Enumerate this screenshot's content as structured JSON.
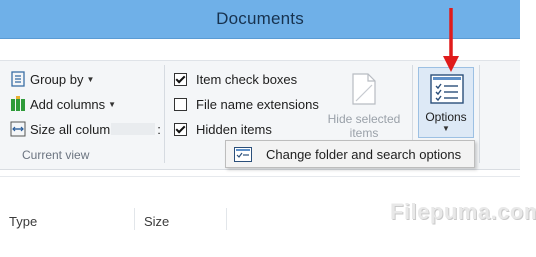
{
  "window": {
    "title": "Documents"
  },
  "ribbon": {
    "layout_group": {
      "group_by": "Group by",
      "add_columns": "Add columns",
      "size_all_columns": "Size all colum",
      "size_all_columns_suffix": ":",
      "caption": "Current view"
    },
    "show_hide_group": {
      "item_check_boxes": {
        "label": "Item check boxes",
        "checked": true
      },
      "file_name_extensions": {
        "label": "File name extensions",
        "checked": false
      },
      "hidden_items": {
        "label": "Hidden items",
        "checked": true
      },
      "hide_selected_line1": "Hide selected",
      "hide_selected_line2": "items"
    },
    "options_button": {
      "label": "Options"
    }
  },
  "popup": {
    "change_folder_options": "Change folder and search options"
  },
  "columns": {
    "type": "Type",
    "size": "Size"
  },
  "watermark": "Filepuma.com",
  "colors": {
    "titlebar": "#6fb0e8",
    "arrow": "#e01b1b"
  },
  "icons": [
    "group-by-icon",
    "add-columns-icon",
    "size-columns-icon",
    "hide-selected-icon",
    "options-icon",
    "folder-options-icon",
    "red-arrow"
  ]
}
